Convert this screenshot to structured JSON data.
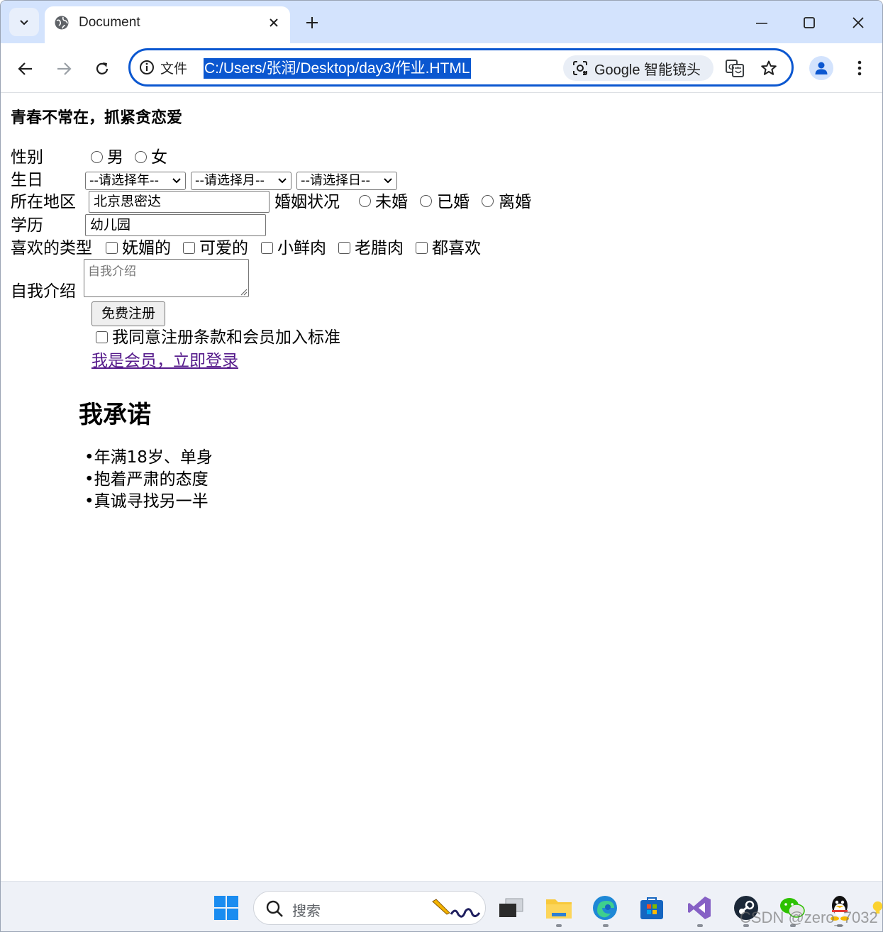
{
  "browser": {
    "tab_title": "Document",
    "site_info_label": "文件",
    "url": "C:/Users/张润/Desktop/day3/作业.HTML",
    "lens_label": "Google 智能镜头"
  },
  "page": {
    "heading": "青春不常在，抓紧贪恋爱",
    "gender": {
      "label": "性别",
      "options": [
        "男",
        "女"
      ]
    },
    "birthday": {
      "label": "生日",
      "year": "--请选择年--",
      "month": "--请选择月--",
      "day": "--请选择日--"
    },
    "region": {
      "label": "所在地区",
      "value": "北京思密达"
    },
    "marital": {
      "label": "婚姻状况",
      "options": [
        "未婚",
        "已婚",
        "离婚"
      ]
    },
    "education": {
      "label": "学历",
      "value": "幼儿园"
    },
    "liked_type": {
      "label": "喜欢的类型",
      "options": [
        "妩媚的",
        "可爱的",
        "小鲜肉",
        "老腊肉",
        "都喜欢"
      ]
    },
    "intro": {
      "label": "自我介绍",
      "placeholder": "自我介绍"
    },
    "register_button": "免费注册",
    "agree_label": "我同意注册条款和会员加入标准",
    "login_link": "我是会员，立即登录",
    "promise": {
      "title": "我承诺",
      "items": [
        "•年满18岁、单身",
        "•抱着严肃的态度",
        "•真诚寻找另一半"
      ]
    }
  },
  "taskbar": {
    "search_label": "搜索",
    "watermark": "CSDN @zero_7032"
  }
}
